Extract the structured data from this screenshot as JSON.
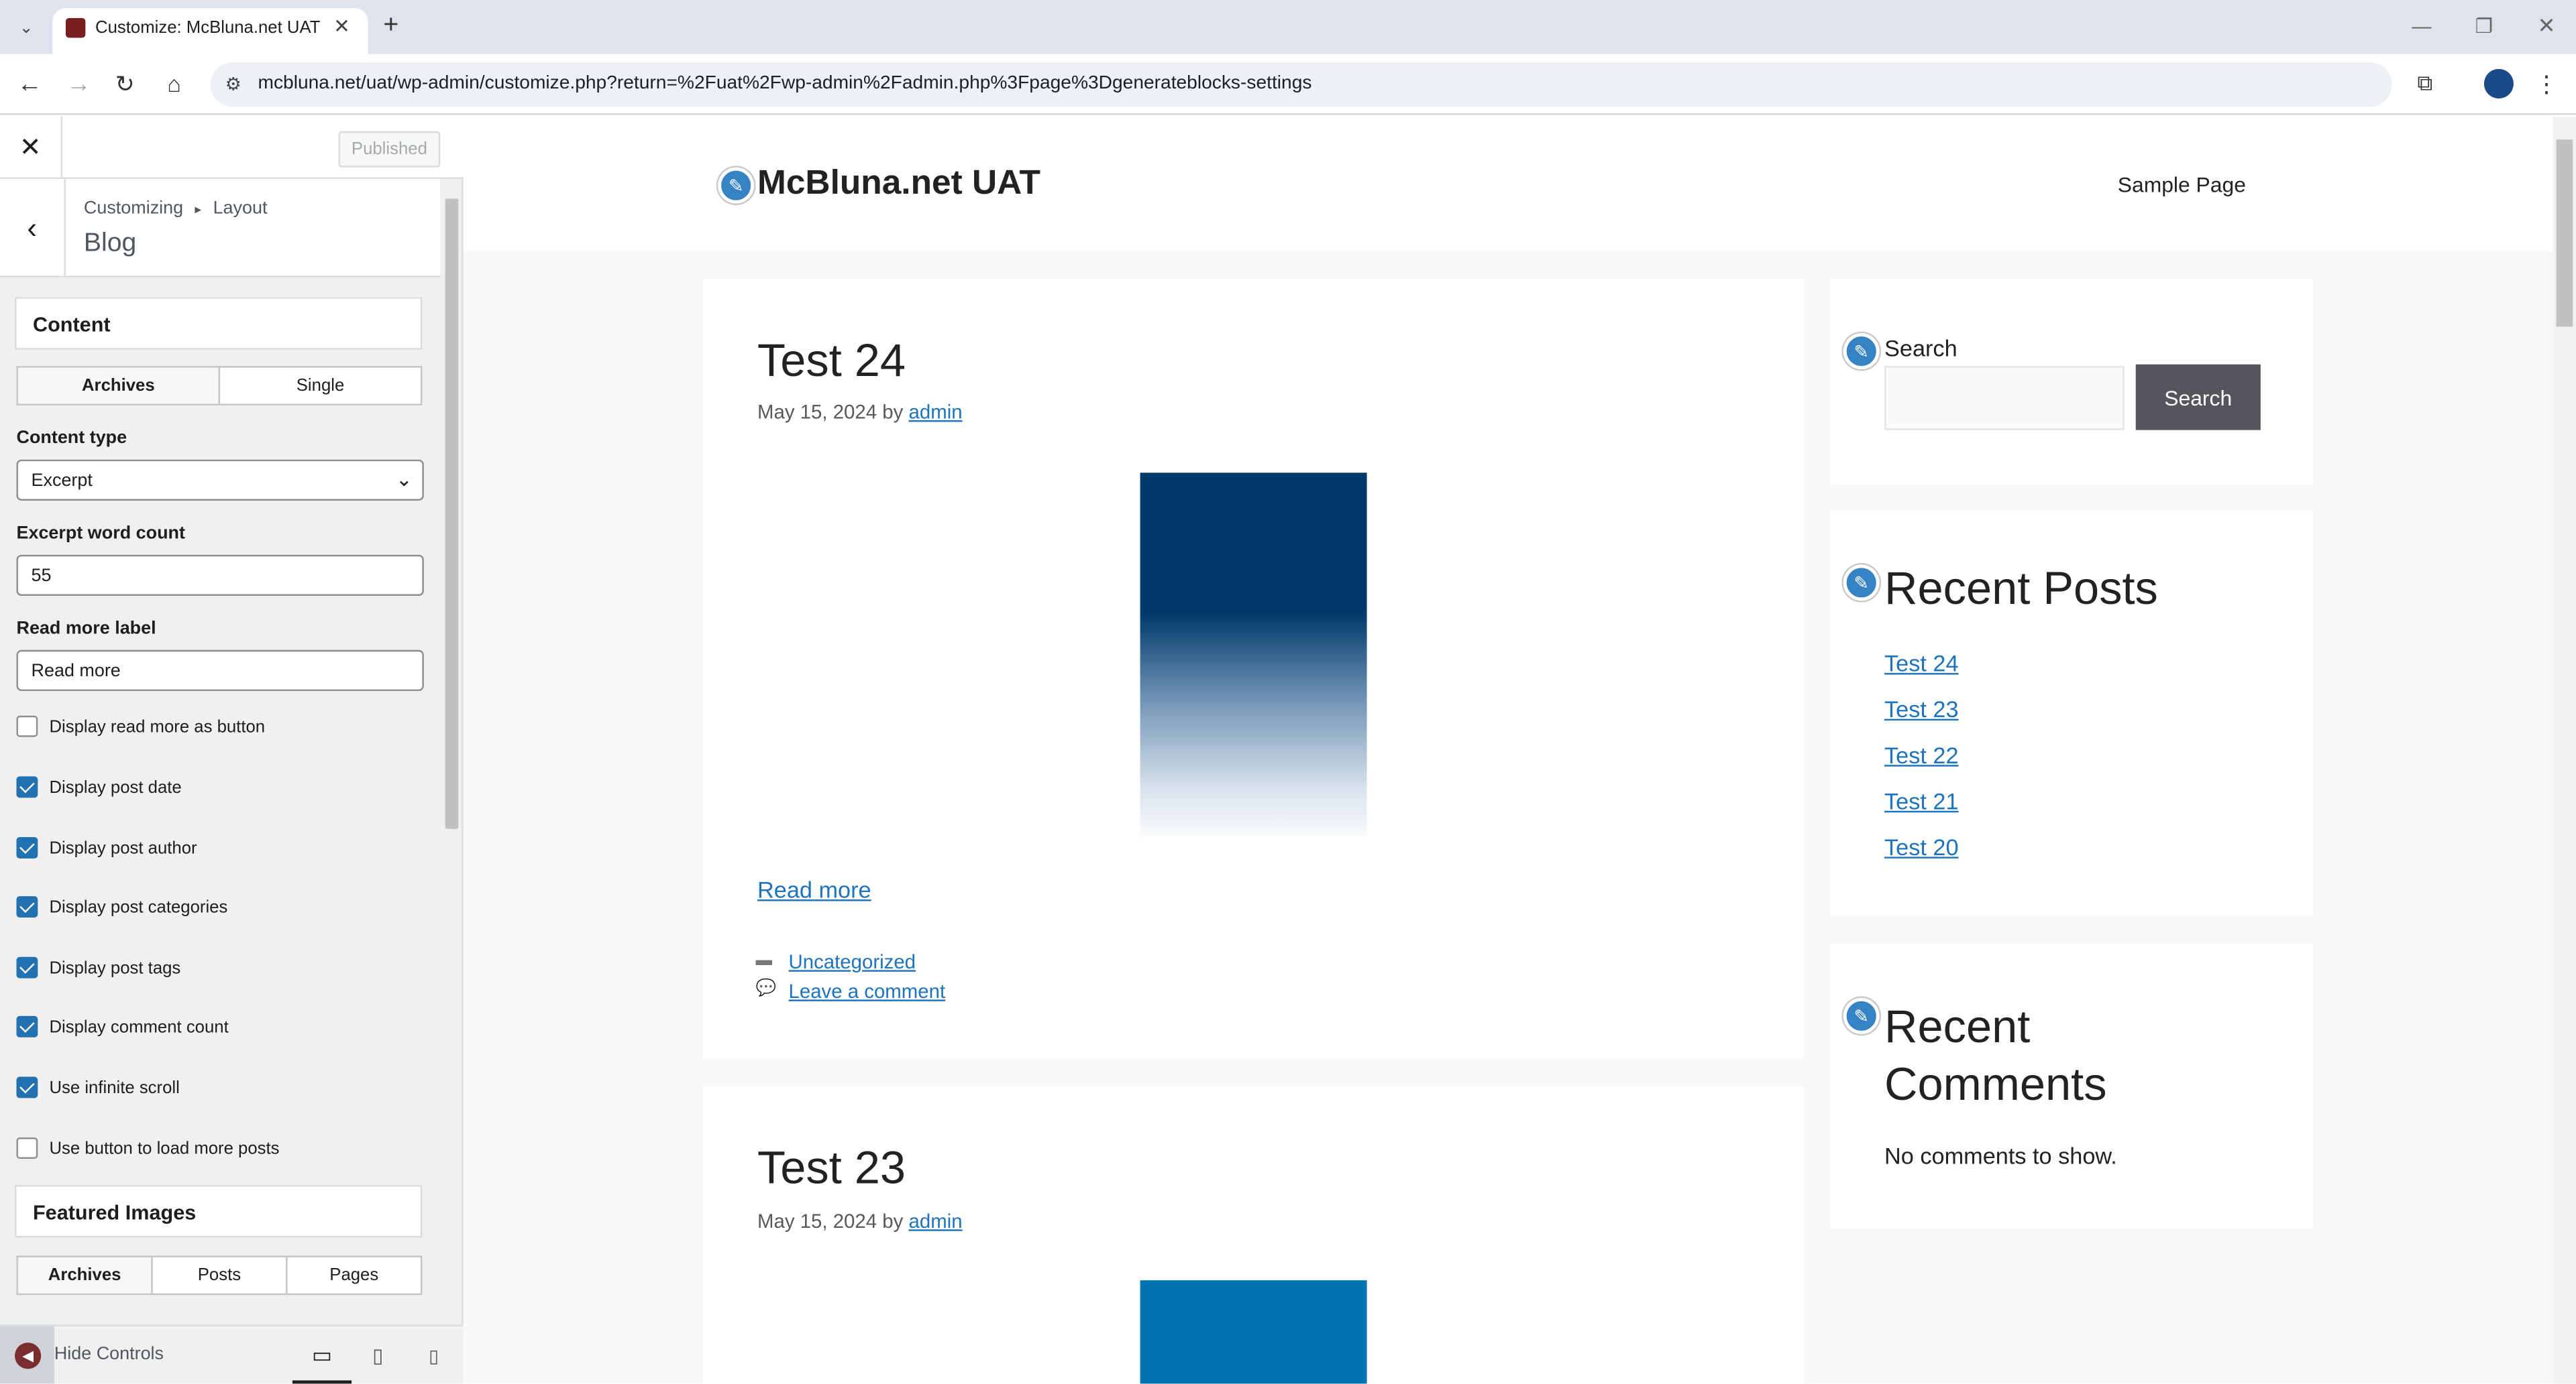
{
  "browser": {
    "tab_title": "Customize: McBluna.net UAT",
    "url": "mcbluna.net/uat/wp-admin/customize.php?return=%2Fuat%2Fwp-admin%2Fadmin.php%3Fpage%3Dgenerateblocks-settings"
  },
  "customizer": {
    "published_label": "Published",
    "breadcrumb_root": "Customizing",
    "breadcrumb_sep": "▸",
    "breadcrumb_section": "Layout",
    "section_title": "Blog",
    "content_heading": "Content",
    "content_tabs": [
      "Archives",
      "Single"
    ],
    "content_type_label": "Content type",
    "content_type_value": "Excerpt",
    "excerpt_label": "Excerpt word count",
    "excerpt_value": "55",
    "readmore_label": "Read more label",
    "readmore_value": "Read more",
    "options": [
      {
        "label": "Display read more as button",
        "checked": false
      },
      {
        "label": "Display post date",
        "checked": true
      },
      {
        "label": "Display post author",
        "checked": true
      },
      {
        "label": "Display post categories",
        "checked": true
      },
      {
        "label": "Display post tags",
        "checked": true
      },
      {
        "label": "Display comment count",
        "checked": true
      },
      {
        "label": "Use infinite scroll",
        "checked": true
      },
      {
        "label": "Use button to load more posts",
        "checked": false
      }
    ],
    "featured_heading": "Featured Images",
    "featured_tabs": [
      "Archives",
      "Posts",
      "Pages"
    ],
    "hide_controls_label": "Hide Controls"
  },
  "site": {
    "title": "McBluna.net UAT",
    "nav_item": "Sample Page",
    "posts": [
      {
        "title": "Test 24",
        "date": "May 15, 2024",
        "by": "by",
        "author": "admin",
        "read_more": "Read more",
        "category": "Uncategorized",
        "comment_link": "Leave a comment"
      },
      {
        "title": "Test 23",
        "date": "May 15, 2024",
        "by": "by",
        "author": "admin"
      }
    ],
    "search_widget_title": "Search",
    "search_button": "Search",
    "recent_posts_title": "Recent Posts",
    "recent_posts": [
      "Test 24",
      "Test 23",
      "Test 22",
      "Test 21",
      "Test 20"
    ],
    "recent_comments_title_1": "Recent",
    "recent_comments_title_2": "Comments",
    "no_comments": "No comments to show."
  }
}
